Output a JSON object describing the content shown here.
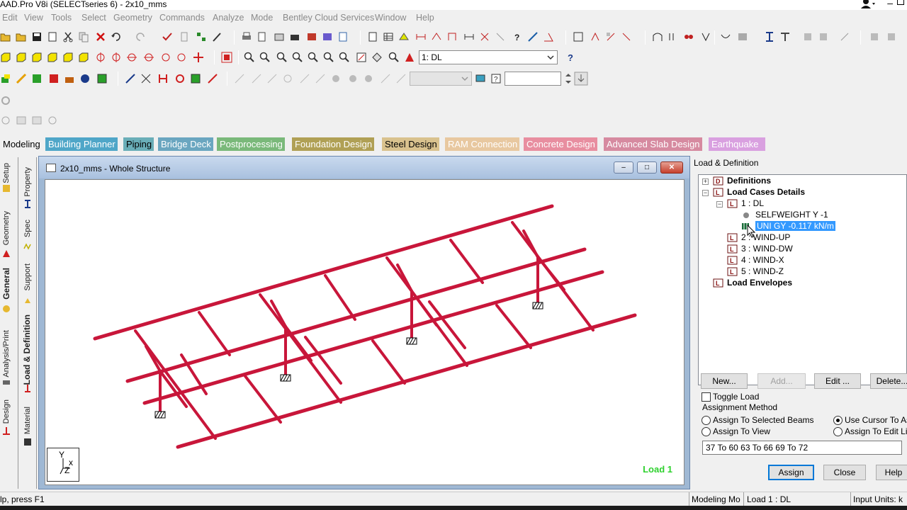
{
  "app": {
    "title": "AAD.Pro V8i (SELECTseries 6) - 2x10_mms"
  },
  "menu": [
    "Edit",
    "View",
    "Tools",
    "Select",
    "Geometry",
    "Commands",
    "Analyze",
    "Mode",
    "Bentley Cloud Services",
    "Window",
    "Help"
  ],
  "toolbar": {
    "load_case_combo": "1: DL",
    "help_icon": "question-icon"
  },
  "page_tabs": [
    {
      "label": "Modeling",
      "color": "#f0f0f0",
      "active": true
    },
    {
      "label": "Building Planner",
      "color": "#4fa6c8"
    },
    {
      "label": "Piping",
      "color": "#6aaeb8"
    },
    {
      "label": "Bridge Deck",
      "color": "#6aa6c0"
    },
    {
      "label": "Postprocessing",
      "color": "#7ab97a"
    },
    {
      "label": "Foundation Design",
      "color": "#b0a055"
    },
    {
      "label": "Steel Design",
      "color": "#d9c28e"
    },
    {
      "label": "RAM Connection",
      "color": "#e8c8a0"
    },
    {
      "label": "Concrete Design",
      "color": "#e88ea0"
    },
    {
      "label": "Advanced Slab Design",
      "color": "#d68aa0"
    },
    {
      "label": "Earthquake",
      "color": "#d9a0e0"
    }
  ],
  "left_tabs_outer": [
    "Setup",
    "Geometry",
    "General",
    "Analysis/Print",
    "Design"
  ],
  "left_tabs_inner": [
    "Property",
    "Spec",
    "Support",
    "Load & Definition",
    "Material"
  ],
  "viewport": {
    "title": "2x10_mms - Whole Structure",
    "load_label": "Load 1",
    "axis_y": "Y",
    "axis_x": "x",
    "axis_z": "Z",
    "member_color": "#c8163a"
  },
  "panel": {
    "title": "Load & Definition",
    "tree": {
      "definitions": "Definitions",
      "load_cases_details": "Load Cases Details",
      "case1": "1 : DL",
      "case1_item1": "SELFWEIGHT Y -1",
      "case1_item2": "UNI GY -0.117 kN/m",
      "case2": "2 : WIND-UP",
      "case3": "3 : WIND-DW",
      "case4": "4 : WIND-X",
      "case5": "5 : WIND-Z",
      "load_envelopes": "Load Envelopes"
    },
    "buttons": {
      "new": "New...",
      "add": "Add...",
      "edit": "Edit ...",
      "delete": "Delete..."
    },
    "toggle_load": "Toggle Load",
    "assignment_method": "Assignment Method",
    "radio_selected_beams": "Assign To Selected Beams",
    "radio_use_cursor": "Use Cursor To Assi",
    "radio_view": "Assign To View",
    "radio_edit_list": "Assign To Edit List",
    "edit_list_value": "37 To 60 63 To 66 69 To 72",
    "assign": "Assign",
    "close": "Close",
    "help": "Help"
  },
  "statusbar": {
    "hint": "lp, press F1",
    "mode": "Modeling Mo",
    "load": "Load 1 : DL",
    "units": "Input Units:  k"
  }
}
